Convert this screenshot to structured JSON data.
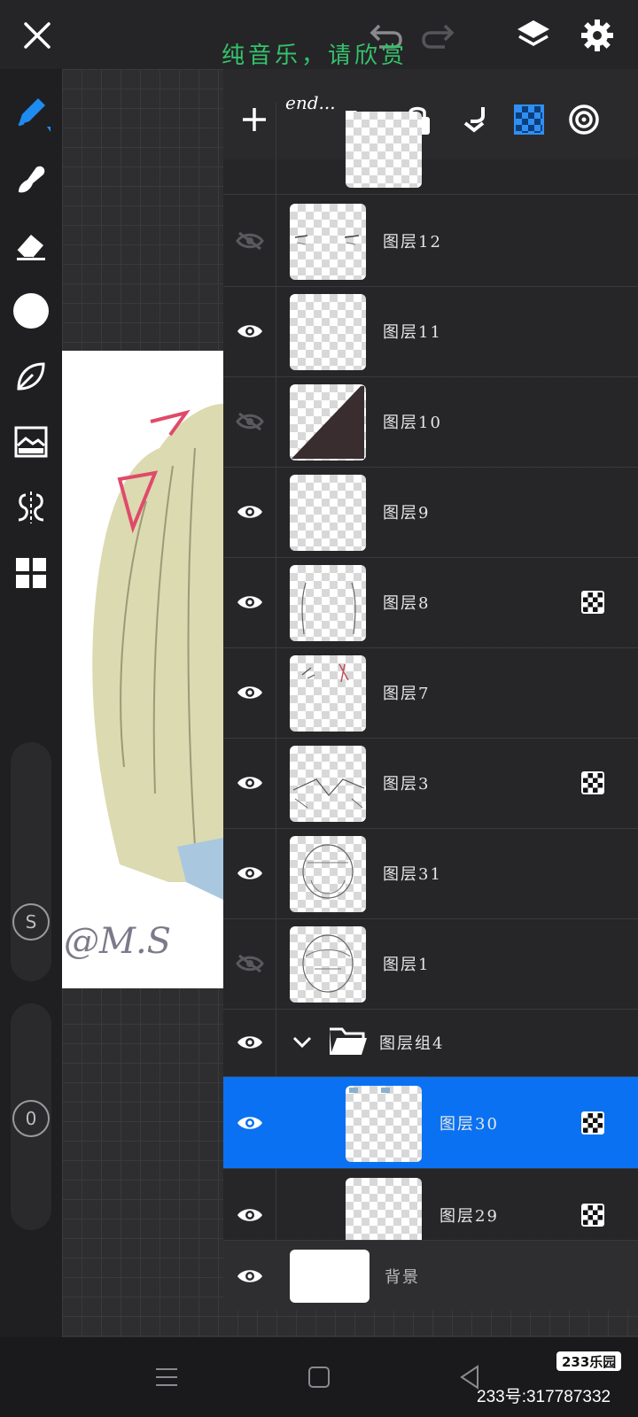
{
  "topbar": {
    "close_icon": "close-icon",
    "undo_icon": "undo-icon",
    "redo_icon": "redo-icon",
    "layers_icon": "layers-icon",
    "settings_icon": "gear-icon",
    "overlay_text": "纯音乐，请欣赏"
  },
  "panel_toolbar": {
    "overlay_text": "end...",
    "icons": [
      "add-icon",
      "folder-icon",
      "lock-icon",
      "merge-down-icon",
      "alpha-lock-icon",
      "layer-target-icon"
    ]
  },
  "layers": [
    {
      "name": "图层12",
      "visible": false,
      "badge": false
    },
    {
      "name": "图层11",
      "visible": true,
      "badge": false
    },
    {
      "name": "图层10",
      "visible": false,
      "badge": false
    },
    {
      "name": "图层9",
      "visible": true,
      "badge": false
    },
    {
      "name": "图层8",
      "visible": true,
      "badge": true
    },
    {
      "name": "图层7",
      "visible": true,
      "badge": false
    },
    {
      "name": "图层3",
      "visible": true,
      "badge": true
    },
    {
      "name": "图层31",
      "visible": true,
      "badge": false
    },
    {
      "name": "图层1",
      "visible": false,
      "badge": false
    },
    {
      "name": "图层组4",
      "visible": true,
      "group": true
    },
    {
      "name": "图层30",
      "visible": true,
      "badge": true,
      "selected": true
    },
    {
      "name": "图层29",
      "visible": true,
      "badge": true
    }
  ],
  "background_layer": {
    "name": "背景",
    "visible": true
  },
  "left_tools": {
    "stabilizer_label": "S",
    "opacity_label": "0"
  },
  "artwork": {
    "signature": "@M.S"
  },
  "footer": {
    "logo": "233乐园",
    "id_text": "233号:317787332"
  },
  "colors": {
    "accent": "#0a72f2",
    "overlay_green": "#34c36b"
  }
}
